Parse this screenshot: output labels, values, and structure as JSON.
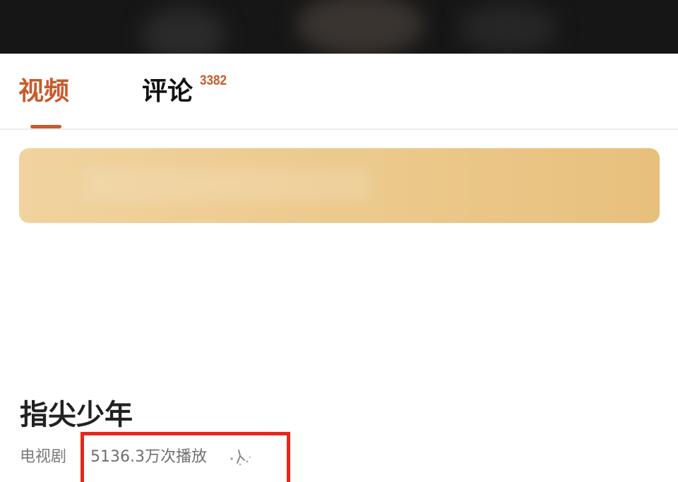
{
  "tabs": {
    "video_label": "视频",
    "comments_label": "评论",
    "comments_count": "3382",
    "active": "video"
  },
  "show": {
    "title": "指尖少年",
    "category": "电视剧",
    "play_count": "5136.3万次播放"
  },
  "icons": {
    "sparkle": "sparkle-icon"
  },
  "colors": {
    "accent": "#c95a2b",
    "banner": "#ecc98c",
    "highlight": "#e5271d"
  }
}
